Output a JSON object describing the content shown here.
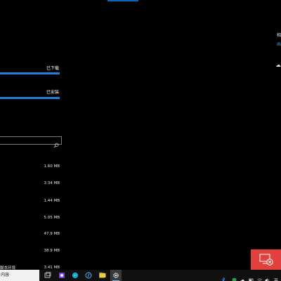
{
  "colors": {
    "accent": "#1f7fdb",
    "toast": "#e23f3f",
    "link": "#3a8fdc"
  },
  "right_panel": {
    "heading_partial": "相",
    "link_partial": "画",
    "icon": "cloud-icon"
  },
  "progress": [
    {
      "label": "已下载",
      "value": 1.0
    },
    {
      "label": "已安装",
      "value": 1.0
    }
  ],
  "search": {
    "placeholder": "",
    "icon": "search-icon"
  },
  "apps": [
    {
      "name": "",
      "size": "1.60 MB"
    },
    {
      "name": "",
      "size": "3.34 MB"
    },
    {
      "name": "",
      "size": "1.44 MB"
    },
    {
      "name": "",
      "size": "5.05 MB"
    },
    {
      "name": "",
      "size": "47.9 MB"
    },
    {
      "name": "",
      "size": "38.9 MB"
    },
    {
      "name": "脚本环境",
      "size": "3.41 MB"
    }
  ],
  "taskbar": {
    "search_text": "内容",
    "items": [
      "task-view-icon",
      "app-icon",
      "edge-icon",
      "store-icon",
      "mail-icon",
      "explorer-icon",
      "settings-icon"
    ],
    "active_item": "settings-icon"
  },
  "toast": {
    "icon": "screen-disconnect-icon"
  }
}
